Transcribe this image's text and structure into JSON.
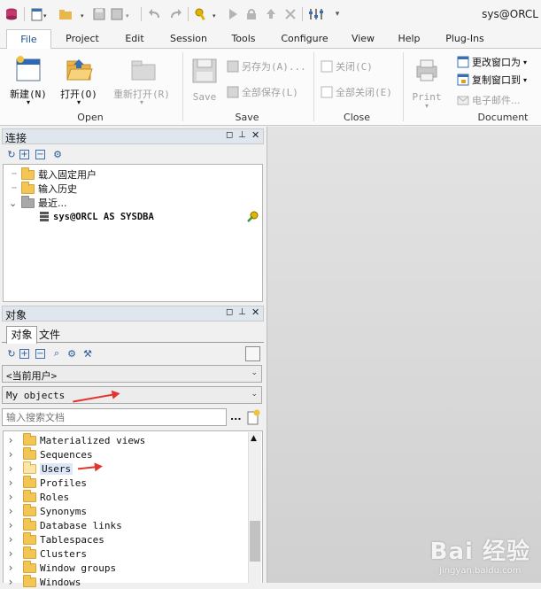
{
  "window": {
    "title": "sys@ORCL"
  },
  "quick_access": {
    "icons": [
      "database-icon",
      "new-document-icon",
      "open-folder-icon",
      "save-icon",
      "save-all-icon",
      "undo-icon",
      "redo-icon",
      "key-icon",
      "run-icon",
      "lock-icon",
      "upload-icon",
      "cancel-icon",
      "settings-icon"
    ]
  },
  "tabs": [
    "File",
    "Project",
    "Edit",
    "Session",
    "Tools",
    "Configure",
    "View",
    "Help",
    "Plug-Ins"
  ],
  "active_tab": "File",
  "ribbon": {
    "open_group": {
      "label": "Open",
      "new": "新建(N)",
      "open": "打开(O)",
      "reopen": "重新打开(R)"
    },
    "save_group": {
      "label": "Save",
      "save": "Save",
      "save_as": "另存为(A)...",
      "save_all": "全部保存(L)"
    },
    "close_group": {
      "label": "Close",
      "close": "关闭(C)",
      "close_all": "全部关闭(E)"
    },
    "document_group": {
      "label": "Document",
      "print": "Print",
      "change_window": "更改窗口为",
      "copy_window": "复制窗口到",
      "email": "电子邮件..."
    }
  },
  "connections_panel": {
    "title": "连接",
    "tree": [
      {
        "label": "载入固定用户"
      },
      {
        "label": "输入历史"
      },
      {
        "label": "最近..."
      },
      {
        "label": "sys@ORCL AS SYSDBA"
      }
    ]
  },
  "objects_panel": {
    "title": "对象",
    "tabs": [
      "对象",
      "文件"
    ],
    "active_tab": "对象",
    "user_combo": "<当前用户>",
    "filter_combo": "My objects",
    "search_placeholder": "输入搜索文档",
    "search_more": "...",
    "items": [
      "Materialized views",
      "Sequences",
      "Users",
      "Profiles",
      "Roles",
      "Synonyms",
      "Database links",
      "Tablespaces",
      "Clusters",
      "Window groups",
      "Windows"
    ],
    "selected_item": "Users"
  },
  "colors": {
    "accent": "#1b4f8c",
    "annotation": "#e2342d"
  },
  "watermark": {
    "brand": "Bai 经验",
    "url": "jingyan.baidu.com"
  }
}
